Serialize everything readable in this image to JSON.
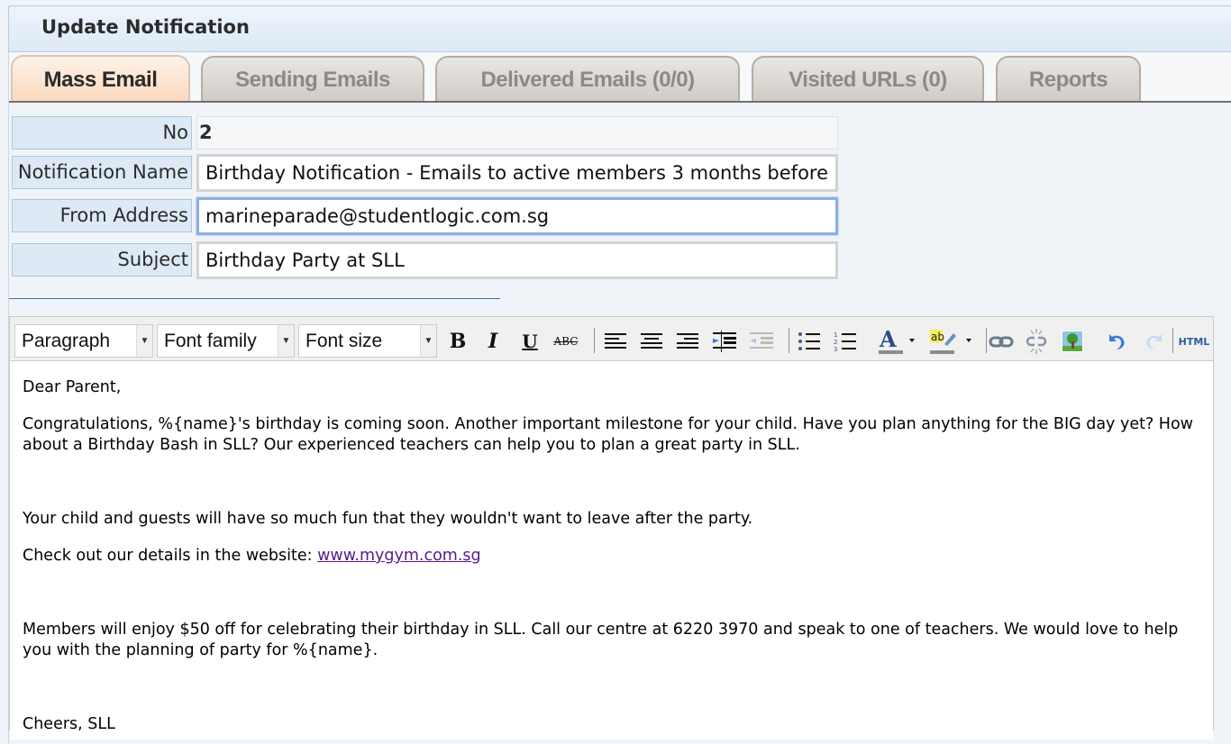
{
  "header": {
    "title": "Update Notification"
  },
  "tabs": [
    {
      "label": "Mass Email",
      "active": true
    },
    {
      "label": "Sending Emails",
      "active": false
    },
    {
      "label": "Delivered Emails (0/0)",
      "active": false
    },
    {
      "label": "Visited URLs (0)",
      "active": false
    },
    {
      "label": "Reports",
      "active": false
    }
  ],
  "form": {
    "no": {
      "label": "No",
      "value": "2"
    },
    "notification_name": {
      "label": "Notification Name",
      "value": "Birthday Notification - Emails to active members 3 months before"
    },
    "from_address": {
      "label": "From Address",
      "value": "marineparade@studentlogic.com.sg"
    },
    "subject": {
      "label": "Subject",
      "value": "Birthday Party at SLL"
    }
  },
  "editor": {
    "toolbar": {
      "format_select": "Paragraph",
      "font_family_select": "Font family",
      "font_size_select": "Font size",
      "buttons": [
        "bold-icon",
        "italic-icon",
        "underline-icon",
        "strikethrough-icon",
        "align-left-icon",
        "align-center-icon",
        "align-right-icon",
        "indent-icon",
        "outdent-icon",
        "bullet-list-icon",
        "numbered-list-icon",
        "text-color-icon",
        "highlight-color-icon",
        "link-icon",
        "unlink-icon",
        "image-icon",
        "undo-icon",
        "redo-icon",
        "html-source-icon"
      ],
      "html_label": "HTML"
    },
    "content": {
      "greeting": "Dear Parent,",
      "para1": "Congratulations, %{name}'s birthday is coming soon. Another important milestone for your child. Have you plan anything for the BIG day yet? How about a Birthday Bash in SLL? Our experienced teachers can help you to plan a great party in SLL.",
      "para2": "Your child and guests will have so much fun that they wouldn't want to leave after the party.",
      "para3_prefix": "Check out our details in the website: ",
      "para3_link": "www.mygym.com.sg",
      "para4": "Members will enjoy $50 off for celebrating their birthday in SLL. Call our centre at 6220 3970 and speak to one of teachers. We would love to help you with the planning of party for %{name}.",
      "signoff": "Cheers, SLL"
    }
  },
  "colors": {
    "header_bg": "#dde9f5",
    "active_tab_bg": "#fad7bb",
    "inactive_tab_bg": "#cfcac4",
    "label_bg": "#dde9f5",
    "focus_border": "#8ab1dc",
    "link": "#551a8b"
  }
}
